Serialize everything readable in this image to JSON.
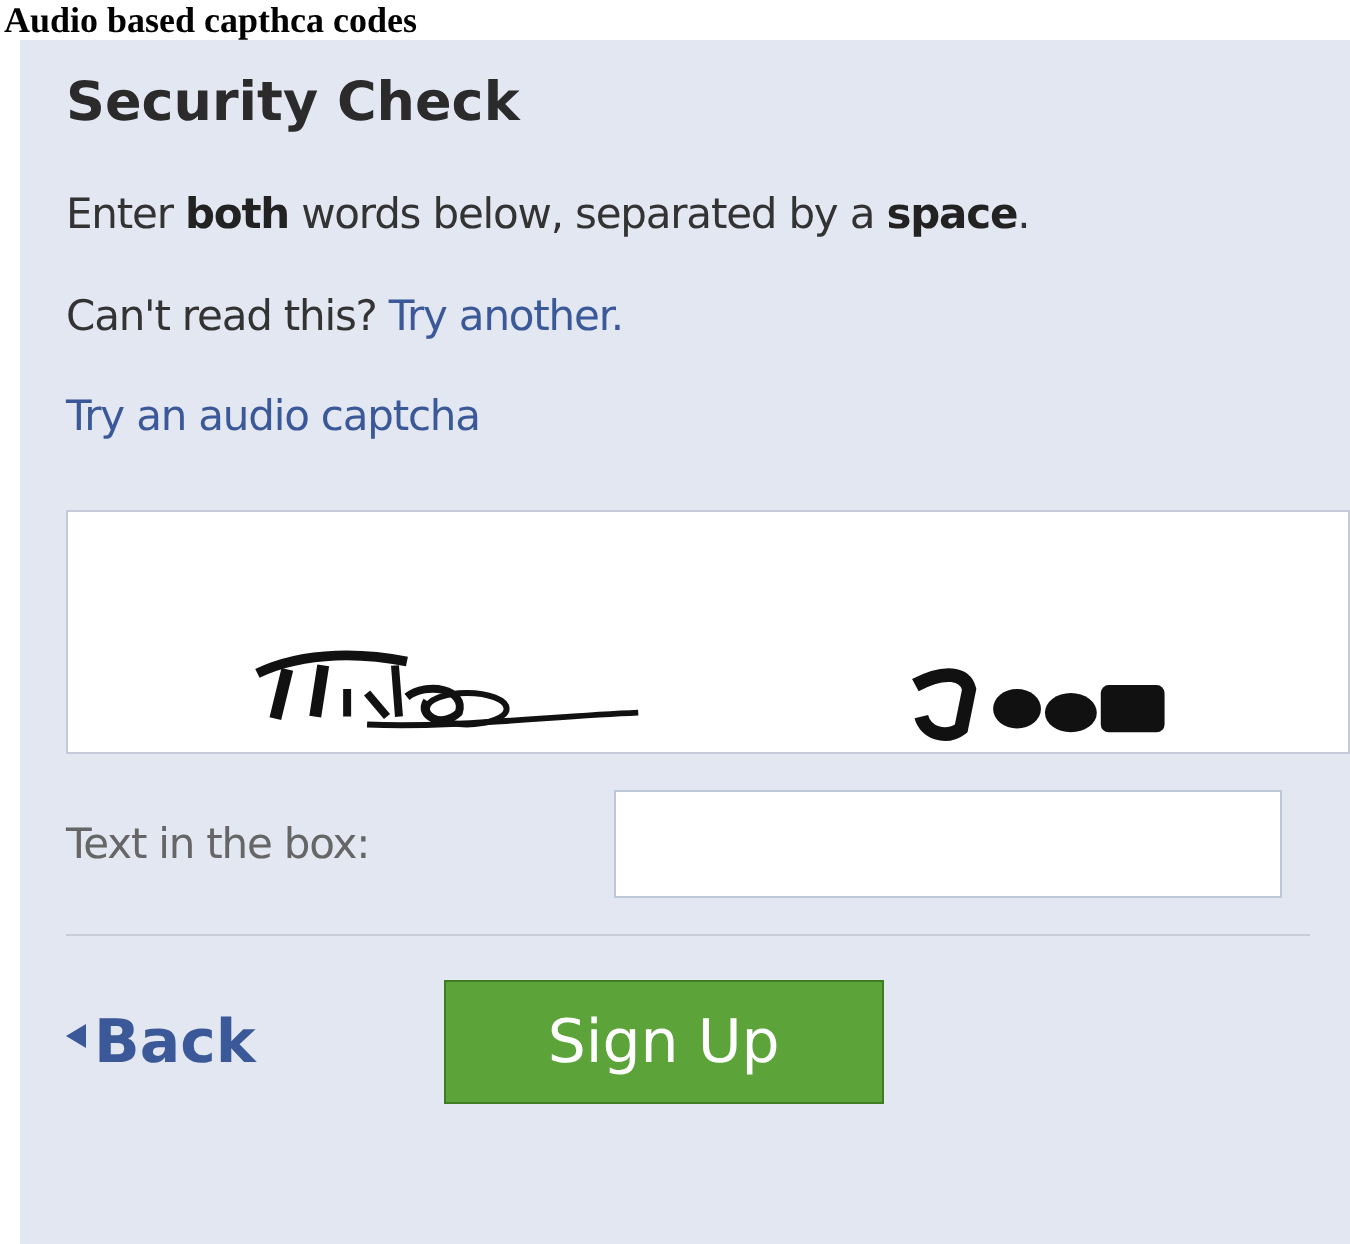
{
  "caption": "Audio based capthca codes",
  "panel": {
    "title": "Security Check",
    "instruction": "Enter **both** words below, separated by a **space**.",
    "cant_read": {
      "text": "Can't read this?",
      "link": "Try another."
    },
    "audio_link": "Try an audio captcha",
    "field": {
      "label": "Text in the box:"
    },
    "back_link": "Back",
    "submit_button": "Sign Up"
  }
}
